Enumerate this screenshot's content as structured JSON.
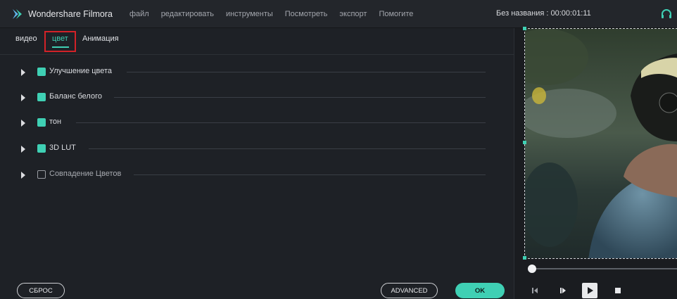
{
  "app": {
    "name": "Wondershare Filmora",
    "project_title": "Без названия : 00:00:01:11",
    "accent": "#3fd0b4"
  },
  "menu": {
    "items": [
      "файл",
      "редактировать",
      "инструменты",
      "Посмотреть",
      "экспорт",
      "Помогите"
    ]
  },
  "tabs": [
    {
      "label": "видео",
      "active": false
    },
    {
      "label": "цвет",
      "active": true
    },
    {
      "label": "Анимация",
      "active": false
    }
  ],
  "sections": [
    {
      "label": "Улучшение цвета",
      "checked": true
    },
    {
      "label": "Баланс белого",
      "checked": true
    },
    {
      "label": "тон",
      "checked": true
    },
    {
      "label": "3D LUT",
      "checked": true
    },
    {
      "label": "Совпадение Цветов",
      "checked": false
    }
  ],
  "buttons": {
    "reset": "СБРОС",
    "advanced": "ADVANCED",
    "ok": "OK"
  },
  "preview": {
    "playhead_fraction": 0.0
  },
  "icons": {
    "logo": "filmora-logo-icon",
    "headset": "headset-icon",
    "prev_frame": "previous-frame-icon",
    "next_frame": "next-frame-icon",
    "play": "play-icon",
    "stop": "stop-icon"
  }
}
